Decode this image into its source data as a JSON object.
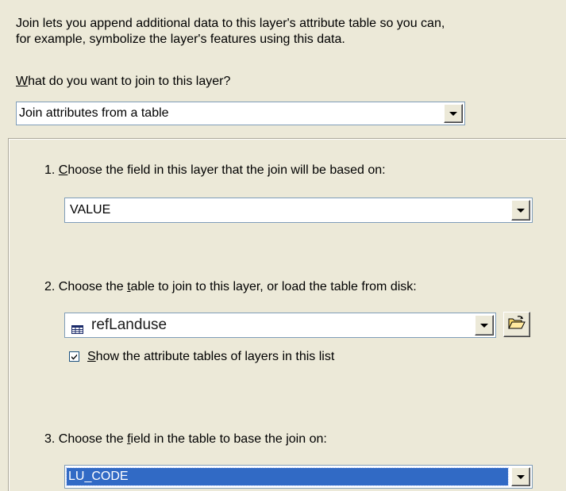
{
  "intro": {
    "line1": "Join lets you append additional data to this layer's attribute table so you can,",
    "line2": "for example, symbolize the layer's features using this data."
  },
  "question": {
    "mnemonic": "W",
    "rest": "hat do you want to join to this layer?"
  },
  "join_type": {
    "value": "Join attributes from a table"
  },
  "step1": {
    "prefix": "1. ",
    "mnemonic": "C",
    "rest": "hoose the field in this layer that the join will be based on:",
    "field_value": "VALUE"
  },
  "step2": {
    "prefix": "2. Choose the ",
    "mnemonic": "t",
    "rest": "able to join to this layer, or load the table from disk:",
    "table_value": "refLanduse",
    "table_icon": "table-icon",
    "browse_icon": "open-folder-icon",
    "checkbox": {
      "checked": true,
      "mnemonic": "S",
      "rest": "how the attribute tables of layers in this list"
    }
  },
  "step3": {
    "prefix": "3. Choose the ",
    "mnemonic": "f",
    "rest": "ield in the table to base the join on:",
    "field_value": "LU_CODE"
  },
  "colors": {
    "background": "#ece9d8",
    "selection": "#316ac5",
    "combo_border": "#7f9db9"
  }
}
